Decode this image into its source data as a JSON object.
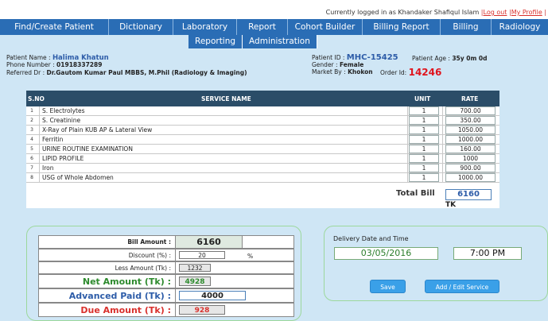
{
  "header": {
    "login_text": "Currently logged in as Khandaker Shafiqul Islam",
    "logout": "Log out",
    "my_profile": "My Profile"
  },
  "nav": {
    "main": [
      "Find/Create Patient",
      "Dictionary",
      "Laboratory",
      "Report",
      "Cohort Builder",
      "Billing Report",
      "Billing",
      "Radiology"
    ],
    "sub": [
      "Reporting",
      "Administration"
    ]
  },
  "patient": {
    "name_label": "Patient Name :",
    "name": "Halima Khatun",
    "phone_label": "Phone Number :",
    "phone": "01918337289",
    "ref_label": "Referred Dr :",
    "ref": "Dr.Gautom Kumar Paul MBBS, M.Phil (Radiology & Imaging)",
    "id_label": "Patient ID :",
    "id": "MHC-15425",
    "age_label": "Patient Age :",
    "age": "35y 0m 0d",
    "gender_label": "Gender :",
    "gender": "Female",
    "market_label": "Market By :",
    "market": "Khokon",
    "order_label": "Order Id:",
    "order_id": "14246"
  },
  "services": {
    "headers": [
      "S.NO",
      "SERVICE NAME",
      "UNIT",
      "RATE"
    ],
    "rows": [
      {
        "sn": "1",
        "name": "S. Electrolytes",
        "unit": "1",
        "rate": "700.00"
      },
      {
        "sn": "2",
        "name": "S. Creatinine",
        "unit": "1",
        "rate": "350.00"
      },
      {
        "sn": "3",
        "name": "X-Ray of Plain KUB AP & Lateral View",
        "unit": "1",
        "rate": "1050.00"
      },
      {
        "sn": "4",
        "name": "Ferritin",
        "unit": "1",
        "rate": "1000.00"
      },
      {
        "sn": "5",
        "name": "URINE ROUTINE EXAMINATION",
        "unit": "1",
        "rate": "160.00"
      },
      {
        "sn": "6",
        "name": "LIPID PROFILE",
        "unit": "1",
        "rate": "1000"
      },
      {
        "sn": "7",
        "name": "Iron",
        "unit": "1",
        "rate": "900.00"
      },
      {
        "sn": "8",
        "name": "USG  of Whole Abdomen",
        "unit": "1",
        "rate": "1000.00"
      }
    ],
    "total_label": "Total Bill",
    "total": "6160",
    "currency": "TK"
  },
  "billing": {
    "bill_amount_label": "Bill Amount :",
    "bill_amount": "6160",
    "discount_label": "Discount (%) :",
    "discount": "20",
    "percent": "%",
    "less_label": "Less Amount (Tk) :",
    "less": "1232",
    "net_label": "Net Amount (Tk) :",
    "net": "4928",
    "advanced_label": "Advanced Paid (Tk) :",
    "advanced": "4000",
    "due_label": "Due Amount (Tk) :",
    "due": "928"
  },
  "delivery": {
    "label": "Delivery Date and Time",
    "date": "03/05/2016",
    "time": "7:00 PM",
    "save": "Save",
    "add_edit": "Add / Edit Service"
  },
  "colors": {
    "nav_bg": "#2a6db5",
    "page_bg": "#cfe6f5",
    "table_header": "#2b4d68",
    "accent_red": "#e0141d",
    "accent_blue": "#2d5ca8",
    "net_green": "#2e8b2e",
    "button": "#3aa0e8"
  }
}
